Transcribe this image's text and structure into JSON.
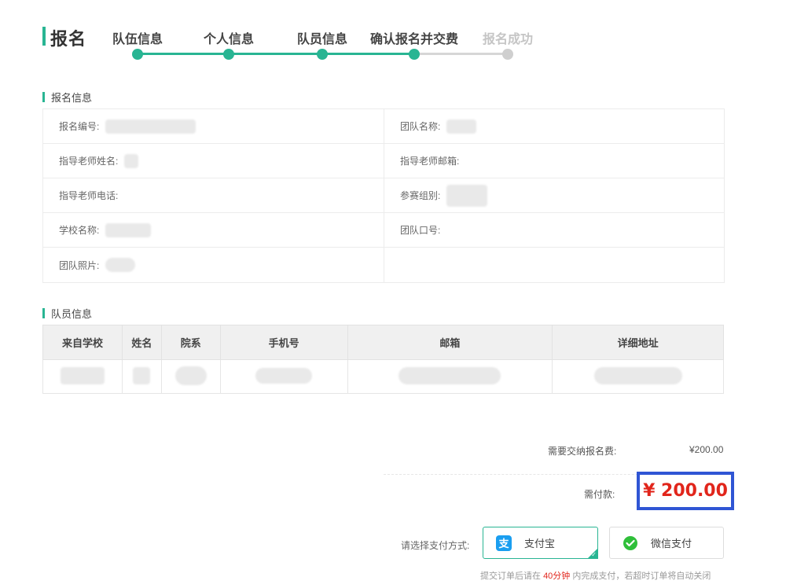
{
  "header": {
    "title": "报名"
  },
  "steps": [
    {
      "label": "队伍信息",
      "status": "done"
    },
    {
      "label": "个人信息",
      "status": "done"
    },
    {
      "label": "队员信息",
      "status": "done"
    },
    {
      "label": "确认报名并交费",
      "status": "current"
    },
    {
      "label": "报名成功",
      "status": "pending"
    }
  ],
  "sections": {
    "info_title": "报名信息",
    "members_title": "队员信息"
  },
  "info": {
    "reg_no_label": "报名编号:",
    "team_name_label": "团队名称:",
    "teacher_name_label": "指导老师姓名:",
    "teacher_email_label": "指导老师邮箱:",
    "teacher_phone_label": "指导老师电话:",
    "group_label": "参赛组别:",
    "school_label": "学校名称:",
    "slogan_label": "团队口号:",
    "photo_label": "团队照片:"
  },
  "members": {
    "columns": [
      "来自学校",
      "姓名",
      "院系",
      "手机号",
      "邮箱",
      "详细地址"
    ]
  },
  "payment": {
    "fee_label": "需要交纳报名费:",
    "fee_value": "¥200.00",
    "pay_label": "需付款:",
    "pay_amount": "¥ 200.00",
    "method_label": "请选择支付方式:",
    "alipay_label": "支付宝",
    "wechat_label": "微信支付",
    "notice_prefix": "提交订单后请在",
    "notice_time": "40分钟",
    "notice_suffix": "内完成支付，若超时订单将自动关闭"
  },
  "colors": {
    "accent": "#29b593",
    "highlight_border": "#2f55d4",
    "price": "#e1251b",
    "pending": "#c5c5c5"
  }
}
